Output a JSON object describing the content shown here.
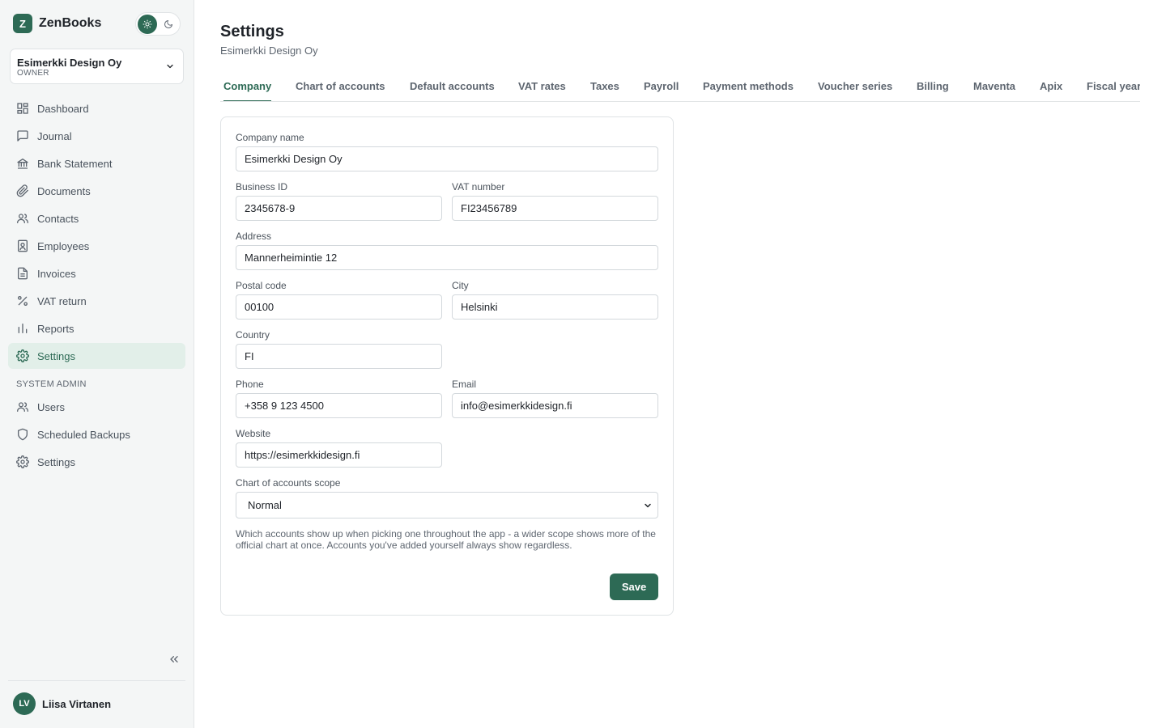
{
  "app": {
    "name": "ZenBooks",
    "logo_letter": "Z",
    "accent": "#2d6a55"
  },
  "theme_toggle": {
    "light_icon": "sun-icon",
    "dark_icon": "moon-icon",
    "active": "light"
  },
  "org": {
    "name": "Esimerkki Design Oy",
    "role": "OWNER"
  },
  "nav": {
    "items": [
      {
        "label": "Dashboard",
        "icon": "dashboard-icon"
      },
      {
        "label": "Journal",
        "icon": "chat-icon"
      },
      {
        "label": "Bank Statement",
        "icon": "bank-icon"
      },
      {
        "label": "Documents",
        "icon": "paperclip-icon"
      },
      {
        "label": "Contacts",
        "icon": "users-icon"
      },
      {
        "label": "Employees",
        "icon": "badge-icon"
      },
      {
        "label": "Invoices",
        "icon": "file-icon"
      },
      {
        "label": "VAT return",
        "icon": "percent-icon"
      },
      {
        "label": "Reports",
        "icon": "bar-chart-icon"
      },
      {
        "label": "Settings",
        "icon": "gear-icon",
        "active": true
      }
    ],
    "admin_section": "SYSTEM ADMIN",
    "admin_items": [
      {
        "label": "Users",
        "icon": "users-icon"
      },
      {
        "label": "Scheduled Backups",
        "icon": "shield-icon"
      },
      {
        "label": "Settings",
        "icon": "gear-icon"
      }
    ]
  },
  "user": {
    "initials": "LV",
    "name": "Liisa Virtanen"
  },
  "page": {
    "title": "Settings",
    "subtitle": "Esimerkki Design Oy"
  },
  "tabs": [
    {
      "label": "Company",
      "active": true
    },
    {
      "label": "Chart of accounts"
    },
    {
      "label": "Default accounts"
    },
    {
      "label": "VAT rates"
    },
    {
      "label": "Taxes"
    },
    {
      "label": "Payroll"
    },
    {
      "label": "Payment methods"
    },
    {
      "label": "Voucher series"
    },
    {
      "label": "Billing"
    },
    {
      "label": "Maventa"
    },
    {
      "label": "Apix"
    },
    {
      "label": "Fiscal year"
    }
  ],
  "form": {
    "company_name": {
      "label": "Company name",
      "value": "Esimerkki Design Oy"
    },
    "business_id": {
      "label": "Business ID",
      "value": "2345678-9"
    },
    "vat_number": {
      "label": "VAT number",
      "value": "FI23456789"
    },
    "address": {
      "label": "Address",
      "value": "Mannerheimintie 12"
    },
    "postal_code": {
      "label": "Postal code",
      "value": "00100"
    },
    "city": {
      "label": "City",
      "value": "Helsinki"
    },
    "country": {
      "label": "Country",
      "value": "FI"
    },
    "phone": {
      "label": "Phone",
      "value": "+358 9 123 4500"
    },
    "email": {
      "label": "Email",
      "value": "info@esimerkkidesign.fi"
    },
    "website": {
      "label": "Website",
      "value": "https://esimerkkidesign.fi"
    },
    "coa_scope": {
      "label": "Chart of accounts scope",
      "value": "Normal"
    },
    "help_text": "Which accounts show up when picking one throughout the app - a wider scope shows more of the official chart at once. Accounts you've added yourself always show regardless.",
    "save_label": "Save"
  }
}
